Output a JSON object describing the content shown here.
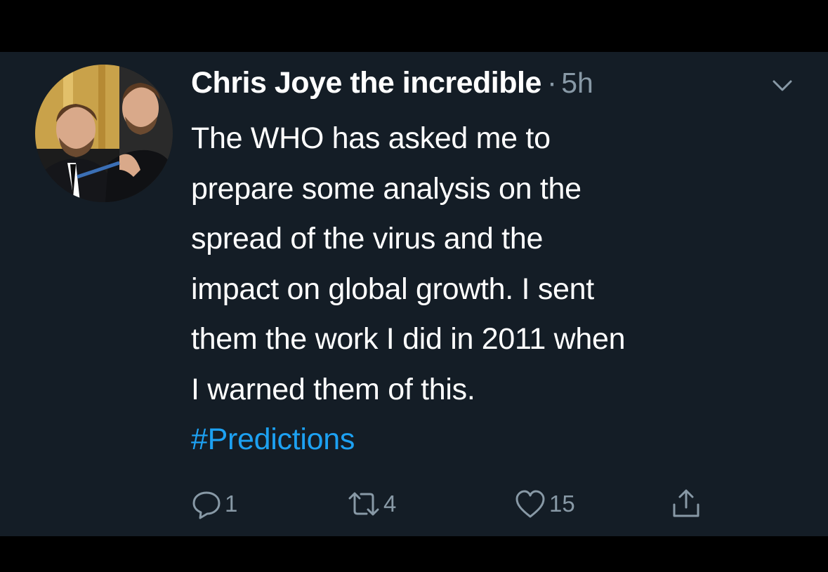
{
  "tweet": {
    "author_name": "Chris Joye the incredible",
    "separator": "·",
    "time": "5h",
    "text_lines": [
      "The WHO has asked me to",
      "prepare some analysis on the",
      "spread of the virus and the",
      "impact on global growth. I sent",
      "them the work I did in 2011 when",
      "I warned them of this."
    ],
    "hashtag": "#Predictions",
    "actions": {
      "reply_count": "1",
      "retweet_count": "4",
      "like_count": "15"
    }
  },
  "icons": {
    "menu": "chevron-down-icon",
    "reply": "reply-icon",
    "retweet": "retweet-icon",
    "like": "heart-icon",
    "share": "share-icon"
  },
  "colors": {
    "background": "#141d26",
    "text": "#ffffff",
    "muted": "#8899a6",
    "link": "#1da1f2"
  }
}
